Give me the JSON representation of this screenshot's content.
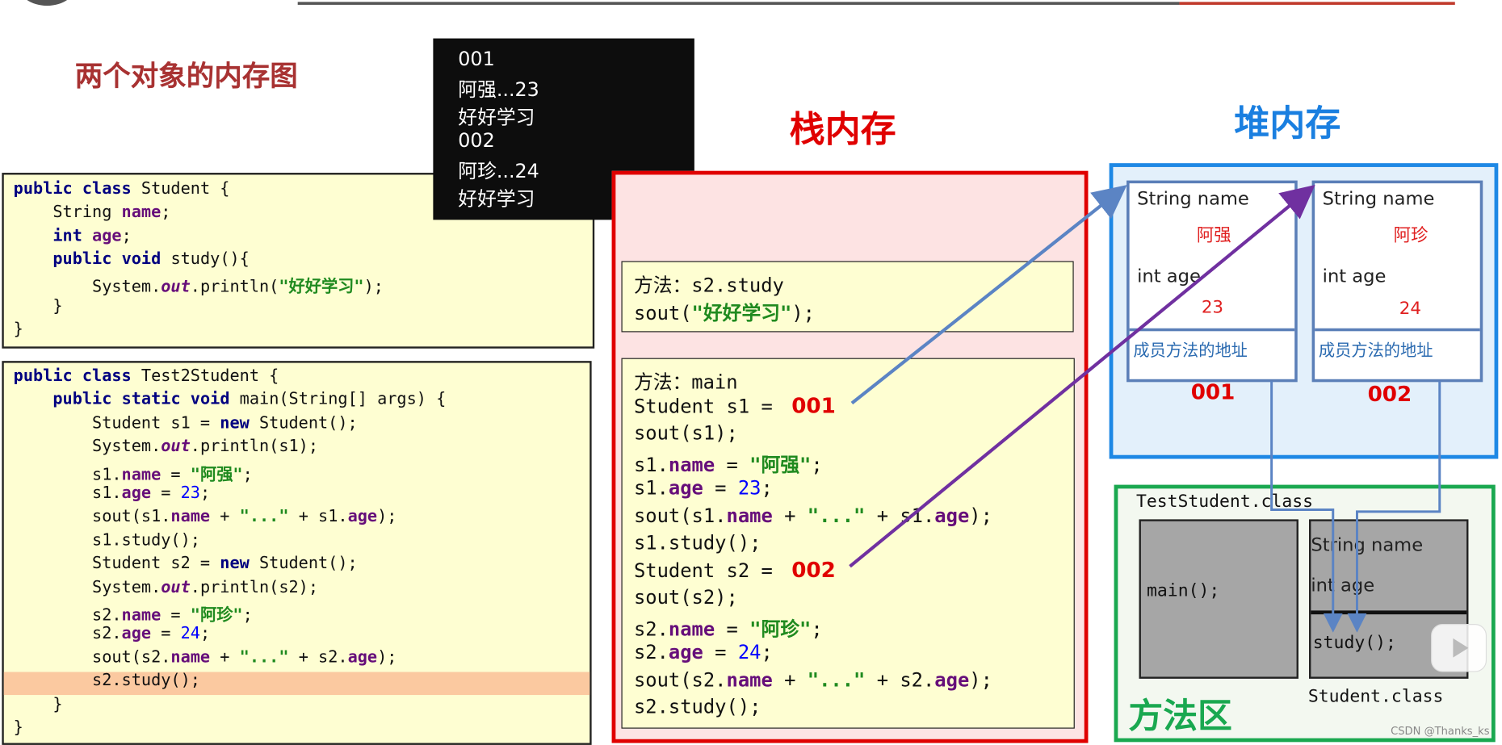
{
  "title": "两个对象的内存图",
  "console_output": [
    "001",
    "阿强...23",
    "好好学习",
    "002",
    "阿珍...24",
    "好好学习"
  ],
  "student_class_code": [
    [
      [
        "public ",
        "kw"
      ],
      [
        "class ",
        "kw"
      ],
      [
        "Student {",
        "plain"
      ]
    ],
    [
      [
        "    String ",
        "plain"
      ],
      [
        "name",
        "field"
      ],
      [
        ";",
        "plain"
      ]
    ],
    [
      [
        "    ",
        "plain"
      ],
      [
        "int ",
        "kw"
      ],
      [
        "age",
        "field"
      ],
      [
        ";",
        "plain"
      ]
    ],
    [
      [
        "    ",
        "plain"
      ],
      [
        "public ",
        "kw"
      ],
      [
        "void ",
        "kw"
      ],
      [
        "study(){",
        "plain"
      ]
    ],
    [
      [
        "        System.",
        "plain"
      ],
      [
        "out",
        "italic"
      ],
      [
        ".println(",
        "plain"
      ],
      [
        "\"好好学习\"",
        "str"
      ],
      [
        ");",
        "plain"
      ]
    ],
    [
      [
        "    }",
        "plain"
      ]
    ],
    [
      [
        "}",
        "plain"
      ]
    ]
  ],
  "test_class_code": [
    [
      [
        "public ",
        "kw"
      ],
      [
        "class ",
        "kw"
      ],
      [
        "Test2Student {",
        "plain"
      ]
    ],
    [
      [
        "    ",
        "plain"
      ],
      [
        "public ",
        "kw"
      ],
      [
        "static ",
        "kw"
      ],
      [
        "void ",
        "kw"
      ],
      [
        "main(String[] args) {",
        "plain"
      ]
    ],
    [
      [
        "        Student s1 = ",
        "plain"
      ],
      [
        "new ",
        "kw"
      ],
      [
        "Student();",
        "plain"
      ]
    ],
    [
      [
        "        System.",
        "plain"
      ],
      [
        "out",
        "italic"
      ],
      [
        ".println(s1);",
        "plain"
      ]
    ],
    [
      [
        "        s1.",
        "plain"
      ],
      [
        "name",
        "field"
      ],
      [
        " = ",
        "plain"
      ],
      [
        "\"阿强\"",
        "str"
      ],
      [
        ";",
        "plain"
      ]
    ],
    [
      [
        "        s1.",
        "plain"
      ],
      [
        "age",
        "field"
      ],
      [
        " = ",
        "plain"
      ],
      [
        "23",
        "num"
      ],
      [
        ";",
        "plain"
      ]
    ],
    [
      [
        "        sout(s1.",
        "plain"
      ],
      [
        "name",
        "field"
      ],
      [
        " + ",
        "plain"
      ],
      [
        "\"...\"",
        "str"
      ],
      [
        " + s1.",
        "plain"
      ],
      [
        "age",
        "field"
      ],
      [
        ");",
        "plain"
      ]
    ],
    [
      [
        "        s1.study();",
        "plain"
      ]
    ],
    [
      [
        "        Student s2 = ",
        "plain"
      ],
      [
        "new ",
        "kw"
      ],
      [
        "Student();",
        "plain"
      ]
    ],
    [
      [
        "        System.",
        "plain"
      ],
      [
        "out",
        "italic"
      ],
      [
        ".println(s2);",
        "plain"
      ]
    ],
    [
      [
        "        s2.",
        "plain"
      ],
      [
        "name",
        "field"
      ],
      [
        " = ",
        "plain"
      ],
      [
        "\"阿珍\"",
        "str"
      ],
      [
        ";",
        "plain"
      ]
    ],
    [
      [
        "        s2.",
        "plain"
      ],
      [
        "age",
        "field"
      ],
      [
        " = ",
        "plain"
      ],
      [
        "24",
        "num"
      ],
      [
        ";",
        "plain"
      ]
    ],
    [
      [
        "        sout(s2.",
        "plain"
      ],
      [
        "name",
        "field"
      ],
      [
        " + ",
        "plain"
      ],
      [
        "\"...\"",
        "str"
      ],
      [
        " + s2.",
        "plain"
      ],
      [
        "age",
        "field"
      ],
      [
        ");",
        "plain"
      ]
    ],
    [
      [
        "        s2.study();",
        "plain"
      ]
    ],
    [
      [
        "    }",
        "plain"
      ]
    ],
    [
      [
        "}",
        "plain"
      ]
    ]
  ],
  "highlighted_line_index": 13,
  "stack": {
    "title": "栈内存",
    "study_frame": [
      [
        [
          "方法：s2.study",
          "plain"
        ]
      ],
      [
        [
          "sout(",
          "plain"
        ],
        [
          "\"好好学习\"",
          "str"
        ],
        [
          ");",
          "plain"
        ]
      ]
    ],
    "main_frame": [
      [
        [
          "方法：main",
          "plain"
        ]
      ],
      [
        [
          "Student s1 = ",
          "plain"
        ],
        [
          " 001",
          "addr"
        ]
      ],
      [
        [
          "sout(s1);",
          "plain"
        ]
      ],
      [
        [
          "s1.",
          "plain"
        ],
        [
          "name",
          "field"
        ],
        [
          " = ",
          "plain"
        ],
        [
          "\"阿强\"",
          "str"
        ],
        [
          ";",
          "plain"
        ]
      ],
      [
        [
          "s1.",
          "plain"
        ],
        [
          "age",
          "field"
        ],
        [
          " = ",
          "plain"
        ],
        [
          "23",
          "num"
        ],
        [
          ";",
          "plain"
        ]
      ],
      [
        [
          "sout(s1.",
          "plain"
        ],
        [
          "name",
          "field"
        ],
        [
          " + ",
          "plain"
        ],
        [
          "\"...\"",
          "str"
        ],
        [
          " + s1.",
          "plain"
        ],
        [
          "age",
          "field"
        ],
        [
          ");",
          "plain"
        ]
      ],
      [
        [
          "s1.study();",
          "plain"
        ]
      ],
      [
        [
          "Student s2 = ",
          "plain"
        ],
        [
          " 002",
          "addr"
        ]
      ],
      [
        [
          "sout(s2);",
          "plain"
        ]
      ],
      [
        [
          "s2.",
          "plain"
        ],
        [
          "name",
          "field"
        ],
        [
          " = ",
          "plain"
        ],
        [
          "\"阿珍\"",
          "str"
        ],
        [
          ";",
          "plain"
        ]
      ],
      [
        [
          "s2.",
          "plain"
        ],
        [
          "age",
          "field"
        ],
        [
          " = ",
          "plain"
        ],
        [
          "24",
          "num"
        ],
        [
          ";",
          "plain"
        ]
      ],
      [
        [
          "sout(s2.",
          "plain"
        ],
        [
          "name",
          "field"
        ],
        [
          " + ",
          "plain"
        ],
        [
          "\"...\"",
          "str"
        ],
        [
          " + s2.",
          "plain"
        ],
        [
          "age",
          "field"
        ],
        [
          ");",
          "plain"
        ]
      ],
      [
        [
          "s2.study();",
          "plain"
        ]
      ]
    ]
  },
  "heap": {
    "title": "堆内存",
    "objects": [
      {
        "name_label": "String name",
        "name_value": "阿强",
        "age_label": "int age",
        "age_value": "23",
        "method_addr": "成员方法的地址",
        "address": "001"
      },
      {
        "name_label": "String name",
        "name_value": "阿珍",
        "age_label": "int age",
        "age_value": "24",
        "method_addr": "成员方法的地址",
        "address": "002"
      }
    ]
  },
  "method_area": {
    "title": "方法区",
    "test_class_label": "TestStudent.class",
    "main_method": "main();",
    "student_class_label": "Student.class",
    "student_fields": [
      "String name",
      "int age"
    ],
    "student_method": "study();"
  },
  "watermark": "CSDN @Thanks_ks",
  "colors": {
    "stack": "#e00000",
    "heap": "#1e88e5",
    "method_area": "#1aa850",
    "arrow_s1": "#5b84c4",
    "arrow_s2": "#7030a0"
  }
}
